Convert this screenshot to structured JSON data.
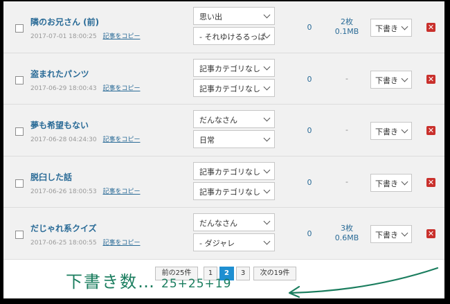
{
  "posts": [
    {
      "title": "隣のお兄さん (前)",
      "date": "2017-07-01 18:00:25",
      "copy": "記事をコピー",
      "category": "思い出",
      "theme": "- それゆけるるっぱ",
      "comments": "0",
      "media_count": "2枚",
      "media_size": "0.1MB",
      "status": "下書き"
    },
    {
      "title": "盗まれたパンツ",
      "date": "2017-06-29 18:00:43",
      "copy": "記事をコピー",
      "category": "記事カテゴリなし",
      "theme": "記事カテゴリなし",
      "comments": "0",
      "media": "-",
      "status": "下書き"
    },
    {
      "title": "夢も希望もない",
      "date": "2017-06-28 04:24:30",
      "copy": "記事をコピー",
      "category": "だんなさん",
      "theme": "日常",
      "comments": "0",
      "media": "-",
      "status": "下書き"
    },
    {
      "title": "脱臼した話",
      "date": "2017-06-26 18:00:53",
      "copy": "記事をコピー",
      "category": "記事カテゴリなし",
      "theme": "記事カテゴリなし",
      "comments": "0",
      "media": "-",
      "status": "下書き"
    },
    {
      "title": "だじゃれ系クイズ",
      "date": "2017-06-25 18:00:55",
      "copy": "記事をコピー",
      "category": "だんなさん",
      "theme": "- ダジャレ",
      "comments": "0",
      "media_count": "3枚",
      "media_size": "0.6MB",
      "status": "下書き"
    }
  ],
  "pagination": {
    "prev": "前の25件",
    "pages": [
      "1",
      "2",
      "3"
    ],
    "current": "2",
    "next": "次の19件"
  },
  "annotation": {
    "label": "下書き数…",
    "formula": "25+25+19"
  },
  "colors": {
    "link": "#2a6b97",
    "delete": "#c9302c",
    "current_page": "#1e8fd1",
    "handwriting": "#1a7d5e"
  }
}
